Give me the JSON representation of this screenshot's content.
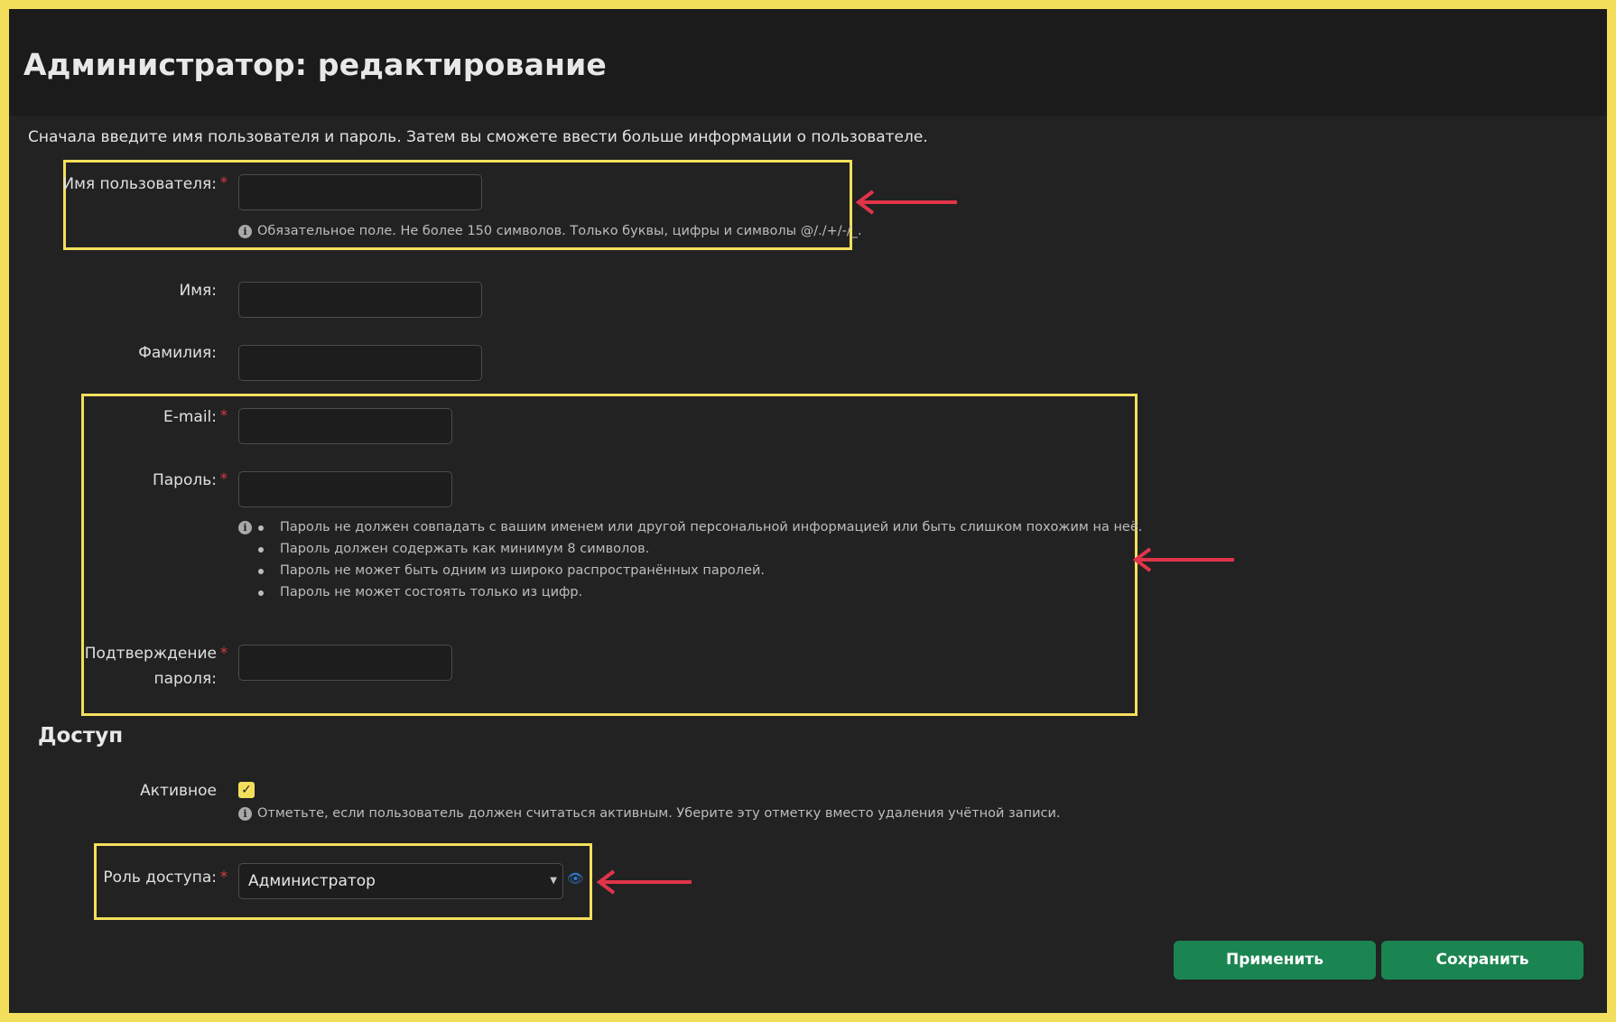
{
  "page": {
    "title": "Администратор: редактирование",
    "intro": "Сначала введите имя пользователя и пароль. Затем вы сможете ввести больше информации о пользователе."
  },
  "form": {
    "username": {
      "label": "Имя пользователя:",
      "required_mark": "*",
      "value": "",
      "help": "Обязательное поле. Не более 150 символов. Только буквы, цифры и символы @/./+/-/_."
    },
    "first_name": {
      "label": "Имя:",
      "value": ""
    },
    "last_name": {
      "label": "Фамилия:",
      "value": ""
    },
    "email": {
      "label": "E-mail:",
      "required_mark": "*",
      "value": ""
    },
    "password": {
      "label": "Пароль:",
      "required_mark": "*",
      "value": "",
      "rules": [
        "Пароль не должен совпадать с вашим именем или другой персональной информацией или быть слишком похожим на неё.",
        "Пароль должен содержать как минимум 8 символов.",
        "Пароль не может быть одним из широко распространённых паролей.",
        "Пароль не может состоять только из цифр."
      ]
    },
    "password_confirm": {
      "label_line1": "Подтверждение",
      "label_line2": "пароля:",
      "required_mark": "*",
      "value": ""
    }
  },
  "access": {
    "section_title": "Доступ",
    "active": {
      "label": "Активное",
      "checked": true,
      "help": "Отметьте, если пользователь должен считаться активным. Уберите эту отметку вместо удаления учётной записи."
    },
    "role": {
      "label": "Роль доступа:",
      "required_mark": "*",
      "selected": "Администратор"
    }
  },
  "buttons": {
    "apply": "Применить",
    "save": "Сохранить"
  },
  "icons": {
    "info": "info-icon",
    "check": "check-icon",
    "caret": "chevron-down-icon",
    "eye": "eye-icon",
    "arrow": "arrow-left-icon"
  },
  "colors": {
    "highlight": "#f4df5c",
    "arrow": "#e0344a",
    "primary_button": "#1b8552",
    "required": "#e03a4a"
  }
}
